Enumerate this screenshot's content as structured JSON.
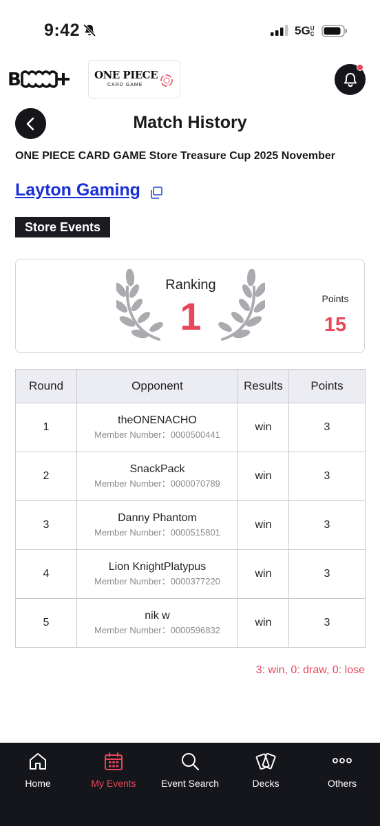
{
  "status_bar": {
    "time": "9:42",
    "network": "5G",
    "network_suffix": "UC"
  },
  "header": {
    "bandai_logo": "B",
    "logo_title": "ONE PIECE",
    "logo_subtitle": "CARD GAME"
  },
  "page": {
    "title": "Match History",
    "event_name": "ONE PIECE CARD GAME Store Treasure Cup 2025 November",
    "store_name": "Layton Gaming",
    "tag": "Store Events"
  },
  "summary": {
    "ranking_label": "Ranking",
    "ranking_value": "1",
    "points_label": "Points",
    "points_value": "15"
  },
  "table": {
    "headers": [
      "Round",
      "Opponent",
      "Results",
      "Points"
    ],
    "member_prefix": "Member Number：",
    "rows": [
      {
        "round": "1",
        "opponent": "theONENACHO",
        "member": "Member Number：0000500441",
        "result": "win",
        "points": "3"
      },
      {
        "round": "2",
        "opponent": "SnackPack",
        "member": "Member Number：0000070789",
        "result": "win",
        "points": "3"
      },
      {
        "round": "3",
        "opponent": "Danny Phantom",
        "member": "Member Number：0000515801",
        "result": "win",
        "points": "3"
      },
      {
        "round": "4",
        "opponent": "Lion KnightPlatypus",
        "member": "Member Number：0000377220",
        "result": "win",
        "points": "3"
      },
      {
        "round": "5",
        "opponent": "nik w",
        "member": "Member Number：0000596832",
        "result": "win",
        "points": "3"
      }
    ]
  },
  "legend": "3: win, 0: draw, 0: lose",
  "nav": {
    "items": [
      {
        "label": "Home",
        "icon": "home-icon",
        "active": false
      },
      {
        "label": "My Events",
        "icon": "calendar-icon",
        "active": true
      },
      {
        "label": "Event Search",
        "icon": "search-icon",
        "active": false
      },
      {
        "label": "Decks",
        "icon": "cards-icon",
        "active": false
      },
      {
        "label": "Others",
        "icon": "more-icon",
        "active": false
      }
    ]
  },
  "colors": {
    "accent": "#e8465a",
    "link": "#1a2fd6",
    "dark": "#15161c",
    "header_bg": "#ececf3"
  }
}
